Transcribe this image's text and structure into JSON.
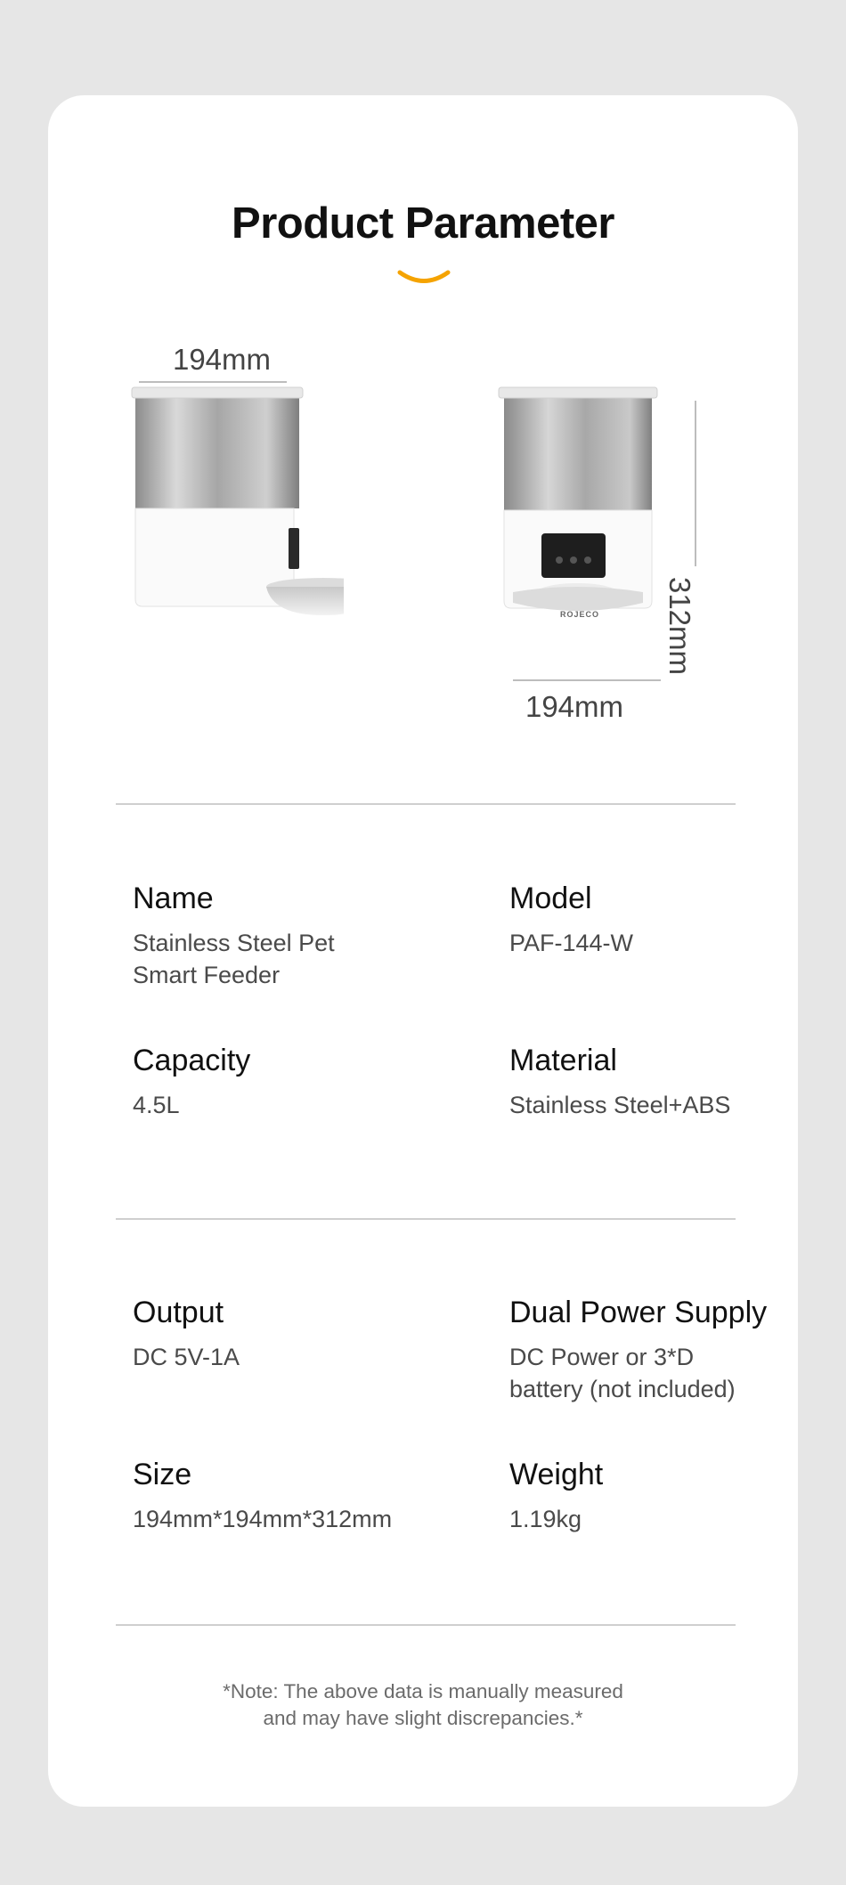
{
  "header": {
    "title": "Product Parameter"
  },
  "dimensions": {
    "side_width": "194mm",
    "front_width": "194mm",
    "front_height": "312mm"
  },
  "product_images": {
    "brand_label": "ROJECO"
  },
  "specs": [
    {
      "label": "Name",
      "value": "Stainless Steel Pet\nSmart Feeder"
    },
    {
      "label": "Model",
      "value": "PAF-144-W"
    },
    {
      "label": "Capacity",
      "value": "4.5L"
    },
    {
      "label": "Material",
      "value": "Stainless Steel+ABS"
    },
    {
      "label": "Output",
      "value": "DC 5V-1A"
    },
    {
      "label": "Dual Power Supply",
      "value": "DC Power or  3*D\nbattery (not included)"
    },
    {
      "label": "Size",
      "value": "194mm*194mm*312mm"
    },
    {
      "label": "Weight",
      "value": "1.19kg"
    }
  ],
  "footer": {
    "note": "*Note: The above data is manually measured\nand may have slight discrepancies.*"
  },
  "colors": {
    "background": "#e6e6e6",
    "card": "#ffffff",
    "accent": "#f5a300"
  }
}
